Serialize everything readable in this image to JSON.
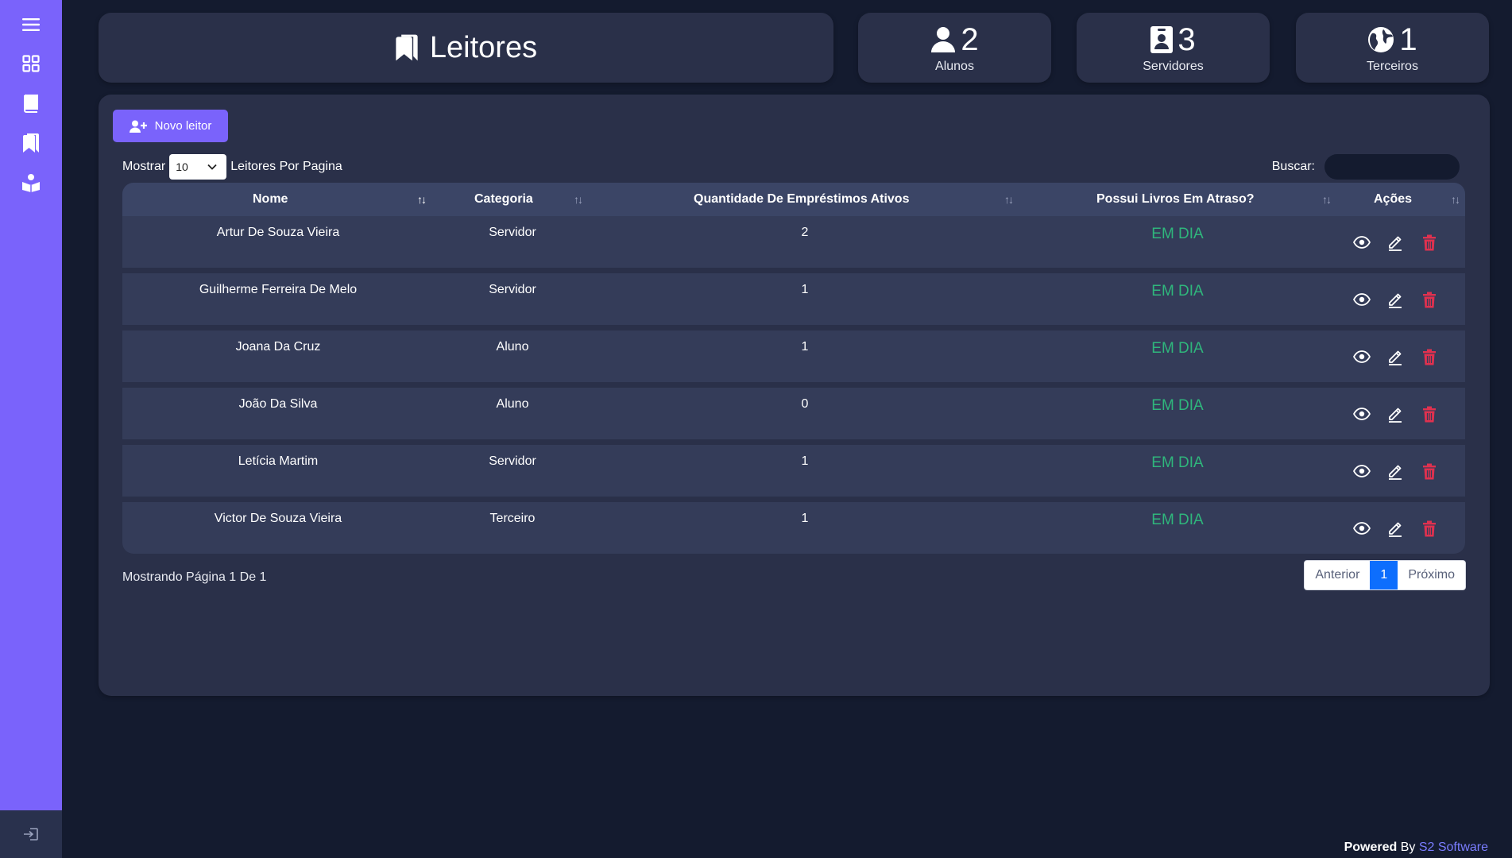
{
  "sidebar": {
    "items": [
      {
        "icon": "menu-icon"
      },
      {
        "icon": "grid-icon"
      },
      {
        "icon": "book-icon"
      },
      {
        "icon": "bookmarks-icon"
      },
      {
        "icon": "reader-icon"
      }
    ],
    "logout_icon": "logout-icon"
  },
  "header": {
    "title": "Leitores",
    "title_icon": "bookmarks-icon"
  },
  "stats": [
    {
      "count": "2",
      "label": "Alunos",
      "icon": "user-icon"
    },
    {
      "count": "3",
      "label": "Servidores",
      "icon": "id-badge-icon"
    },
    {
      "count": "1",
      "label": "Terceiros",
      "icon": "globe-icon"
    }
  ],
  "toolbar": {
    "new_label": "Novo leitor"
  },
  "length": {
    "prefix": "Mostrar",
    "value": "10",
    "suffix": "Leitores Por Pagina"
  },
  "search": {
    "label": "Buscar:",
    "value": ""
  },
  "table": {
    "columns": [
      "Nome",
      "Categoria",
      "Quantidade De Empréstimos Ativos",
      "Possui Livros Em Atraso?",
      "Ações"
    ],
    "rows": [
      {
        "name": "Artur De Souza Vieira",
        "category": "Servidor",
        "loans": "2",
        "status": "EM DIA"
      },
      {
        "name": "Guilherme Ferreira De Melo",
        "category": "Servidor",
        "loans": "1",
        "status": "EM DIA"
      },
      {
        "name": "Joana Da Cruz",
        "category": "Aluno",
        "loans": "1",
        "status": "EM DIA"
      },
      {
        "name": "João Da Silva",
        "category": "Aluno",
        "loans": "0",
        "status": "EM DIA"
      },
      {
        "name": "Letícia Martim",
        "category": "Servidor",
        "loans": "1",
        "status": "EM DIA"
      },
      {
        "name": "Victor De Souza Vieira",
        "category": "Terceiro",
        "loans": "1",
        "status": "EM DIA"
      }
    ]
  },
  "pagination": {
    "info": "Mostrando Página 1 De 1",
    "prev": "Anterior",
    "current": "1",
    "next": "Próximo"
  },
  "footer": {
    "powered_prefix": "Powered",
    "powered_by": " By ",
    "brand": "S2 Software"
  },
  "colors": {
    "accent": "#7a63fb",
    "background": "#141b2f",
    "card": "#2a3049",
    "status_ok": "#2fb67c",
    "delete": "#e0314f",
    "page_active": "#0d6efd"
  }
}
